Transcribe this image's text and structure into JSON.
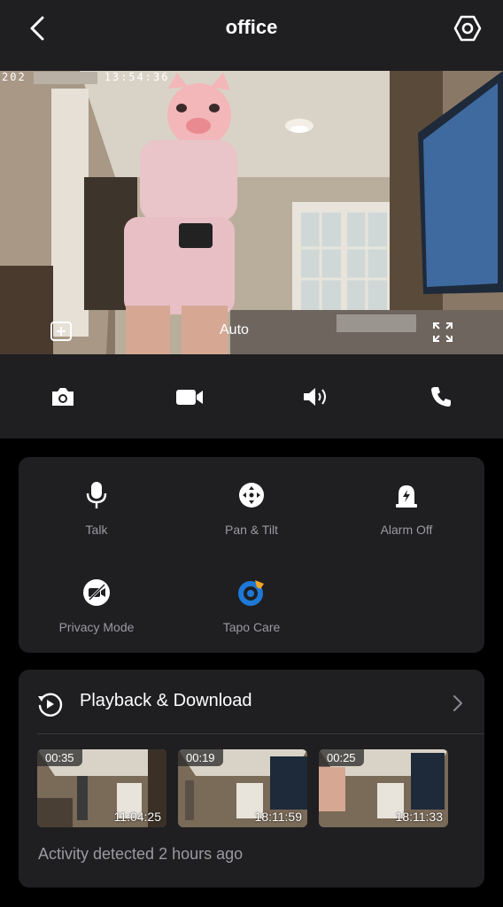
{
  "header": {
    "title": "office"
  },
  "live_view": {
    "osd_date_prefix": "202",
    "osd_time": "13:54:36",
    "quality_label": "Auto"
  },
  "features": [
    {
      "label": "Talk",
      "icon": "microphone-icon"
    },
    {
      "label": "Pan & Tilt",
      "icon": "pan-tilt-icon"
    },
    {
      "label": "Alarm Off",
      "icon": "alarm-icon"
    },
    {
      "label": "Privacy Mode",
      "icon": "privacy-camera-off-icon"
    },
    {
      "label": "Tapo Care",
      "icon": "tapo-care-icon"
    }
  ],
  "playback": {
    "title": "Playback & Download",
    "clips": [
      {
        "duration": "00:35",
        "time": "11:04:25"
      },
      {
        "duration": "00:19",
        "time": "18:11:59"
      },
      {
        "duration": "00:25",
        "time": "18:11:33"
      }
    ],
    "activity_text": "Activity detected 2 hours ago"
  },
  "colors": {
    "panel": "#1f1f22",
    "background": "#000000",
    "muted_text": "#9a9aa0",
    "tapo_blue": "#1e78d6",
    "tapo_orange": "#f5a623"
  }
}
